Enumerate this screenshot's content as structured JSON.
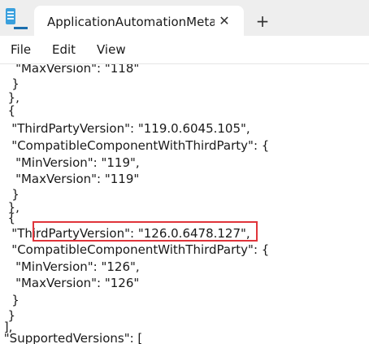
{
  "tab": {
    "title": "ApplicationAutomationMetadata.j",
    "close_glyph": "✕",
    "new_tab_glyph": "+"
  },
  "menu": {
    "file": "File",
    "edit": "Edit",
    "view": "View"
  },
  "editor": {
    "lines": [
      "    \"MaxVersion\": \"118\"",
      "   }",
      "  },",
      "  {",
      "   \"ThirdPartyVersion\": \"119.0.6045.105\",",
      "   \"CompatibleComponentWithThirdParty\": {",
      "    \"MinVersion\": \"119\",",
      "    \"MaxVersion\": \"119\"",
      "   }",
      "  },",
      "  {",
      "   \"ThirdPartyVersion\": \"126.0.6478.127\",",
      "   \"CompatibleComponentWithThirdParty\": {",
      "    \"MinVersion\": \"126\",",
      "    \"MaxVersion\": \"126\"",
      "   }",
      "  }",
      " ],",
      " \"SupportedVersions\": ["
    ],
    "highlight_color": "#e0343a"
  }
}
